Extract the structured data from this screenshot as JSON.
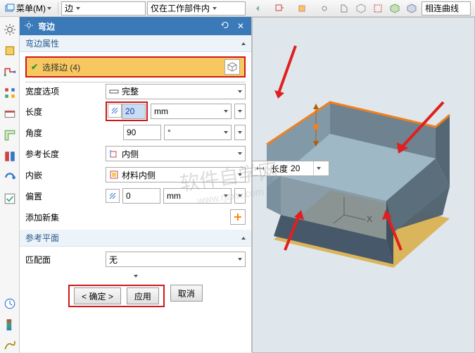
{
  "menu": {
    "label": "菜单(M)"
  },
  "top": {
    "filter1": "边",
    "filter2": "仅在工作部件内",
    "right_label": "相连曲线"
  },
  "panel": {
    "title": "弯边",
    "sections": {
      "bend_props": {
        "header": "弯边属性",
        "select_edge": "选择边 (4)",
        "width_option_label": "宽度选项",
        "width_option_value": "完整",
        "length_label": "长度",
        "length_value": "20",
        "length_unit": "mm",
        "angle_label": "角度",
        "angle_value": "90",
        "angle_unit": "°",
        "ref_len_label": "参考长度",
        "ref_len_value": "内侧",
        "inset_label": "内嵌",
        "inset_value": "材料内侧",
        "offset_label": "偏置",
        "offset_value": "0",
        "offset_unit": "mm",
        "addset_label": "添加新集"
      },
      "ref_plane": {
        "header": "参考平面",
        "match_label": "匹配面",
        "match_value": "无"
      }
    },
    "buttons": {
      "ok": "< 确定 >",
      "apply": "应用",
      "cancel": "取消"
    }
  },
  "hover": {
    "label": "长度",
    "value": "20"
  },
  "icons": {
    "gear": "gear-icon",
    "pin": "pin-icon",
    "close": "close-icon",
    "cube": "cube-icon",
    "measure": "measure-icon",
    "ref_in": "ref-inside-icon",
    "mat_in": "material-inside-icon",
    "plus": "plus-icon"
  }
}
